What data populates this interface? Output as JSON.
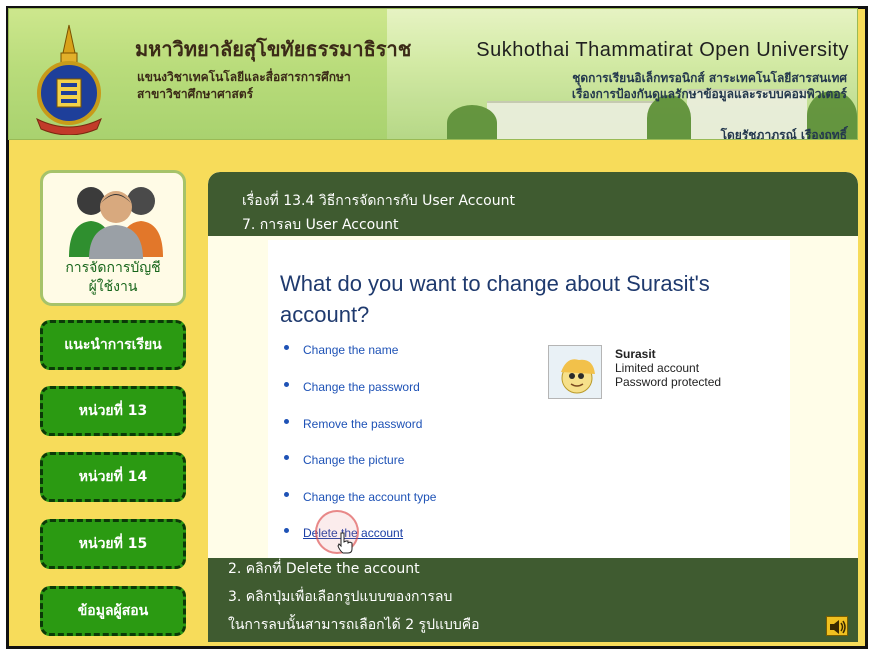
{
  "header": {
    "th_title": "มหาวิทยาลัยสุโขทัยธรรมาธิราช",
    "th_sub1": "แขนงวิชาเทคโนโลยีและสื่อสารการศึกษา",
    "th_sub2": "สาขาวิชาศึกษาศาสตร์",
    "en_title": "Sukhothai Thammatirat Open University",
    "series_line1": "ชุดการเรียนอิเล็กทรอนิกส์ สาระเทคโนโลยีสารสนเทศ",
    "series_line2": "เรื่องการป้องกันดูแลรักษาข้อมูลและระบบคอมพิวเตอร์",
    "author": "โดยรัชฎาภรณ์ เรืองฤทธิ์"
  },
  "sidebar": {
    "profile_label_1": "การจัดการบัญชี",
    "profile_label_2": "ผู้ใช้งาน",
    "items": [
      {
        "label": "แนะนำการเรียน"
      },
      {
        "label": "หน่วยที่ 13"
      },
      {
        "label": "หน่วยที่ 14"
      },
      {
        "label": "หน่วยที่ 15"
      },
      {
        "label": "ข้อมูลผู้สอน"
      }
    ]
  },
  "lesson": {
    "topic": "เรื่องที่ 13.4 วิธีการจัดการกับ User Account",
    "step": "7. การลบ User Account"
  },
  "screenshot": {
    "question": "What do you want to change about Surasit's account?",
    "options": [
      {
        "label": "Change the name"
      },
      {
        "label": "Change the password"
      },
      {
        "label": "Remove the password"
      },
      {
        "label": "Change the picture"
      },
      {
        "label": "Change the account type"
      },
      {
        "label": "Delete the account"
      }
    ],
    "account": {
      "name": "Surasit",
      "type": "Limited account",
      "protection": "Password protected"
    }
  },
  "footer": {
    "line1": "2. คลิกที่ Delete the account",
    "line2": "3. คลิกปุ่มเพื่อเลือกรูปแบบของการลบ",
    "line3": "ในการลบนั้นสามารถเลือกได้ 2 รูปแบบคือ"
  },
  "colors": {
    "nav_green": "#2b9a12",
    "panel_dark": "#3f5b30",
    "link_blue": "#1e52b6",
    "page_yellow": "#f7dc5a"
  },
  "icons": {
    "speaker": "speaker-icon",
    "cursor": "hand-cursor-icon",
    "users": "users-group-icon",
    "logo": "university-emblem-icon"
  }
}
